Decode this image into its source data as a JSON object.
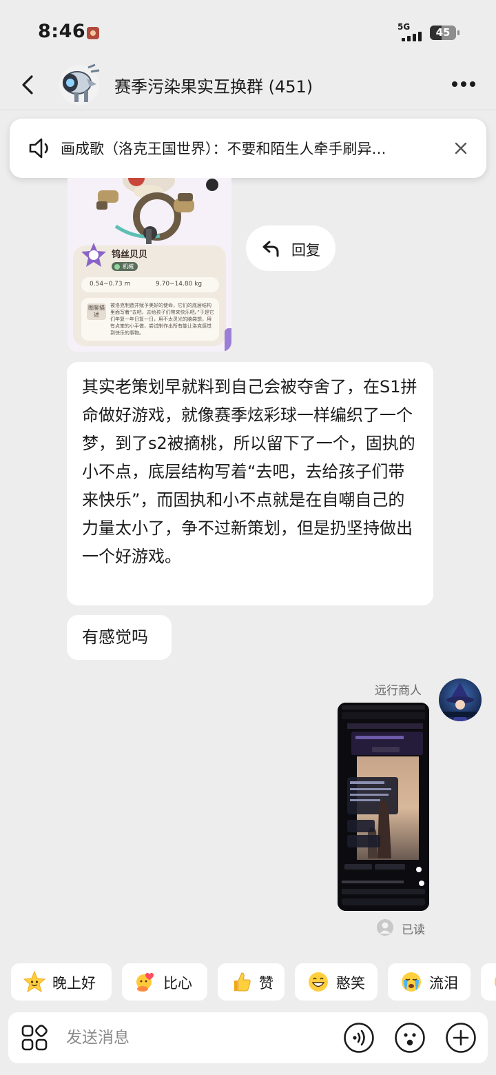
{
  "status_bar": {
    "time": "8:46",
    "network": "5G",
    "battery": "45",
    "battery_level": 0.45
  },
  "header": {
    "title": "赛季污染果实互换群 (451)"
  },
  "announcement": {
    "text": "画成歌（洛克王国世界）：不要和陌生人牵手刷异…"
  },
  "image_card": {
    "creature_name": "钨丝贝贝",
    "creature_type": "机械",
    "height_range": "0.54~0.73 m",
    "weight_range": "9.70~14.80 kg",
    "desc_tag": "图鉴描述",
    "description": "被洛克制造并赋予美好的使命，它们的底层结构里面写着“去吧，去给孩子们带来快乐吧。”于是它们年复一年日复一日，用不太灵光的脑袋想，用有点笨的小手做，尝试制作出所有能让洛克感觉到快乐的事物。"
  },
  "reply_action": {
    "label": "回复"
  },
  "messages": {
    "long_text": "其实老策划早就料到自己会被夺舍了，在S1拼命做好游戏，就像赛季炫彩球一样编织了一个梦，到了s2被摘桃，所以留下了一个，固执的小不点，底层结构写着“去吧，去给孩子们带来快乐”，而固执和小不点就是在自嘲自己的力量太小了，争不过新策划，但是扔坚持做出一个好游戏。",
    "short_text": "有感觉吗"
  },
  "outgoing": {
    "sender_name": "远行商人",
    "read_status": "已读"
  },
  "quick_replies": [
    {
      "label": "晚上好",
      "icon": "star-face-icon"
    },
    {
      "label": "比心",
      "icon": "heart-hands-icon"
    },
    {
      "label": "赞",
      "icon": "thumbs-up-icon"
    },
    {
      "label": "憨笑",
      "icon": "grin-face-icon"
    },
    {
      "label": "流泪",
      "icon": "crying-face-icon"
    }
  ],
  "composer": {
    "placeholder": "发送消息"
  },
  "colors": {
    "background": "#ededed",
    "bubble": "#ffffff",
    "text": "#1b1b1b",
    "muted": "#666666"
  }
}
